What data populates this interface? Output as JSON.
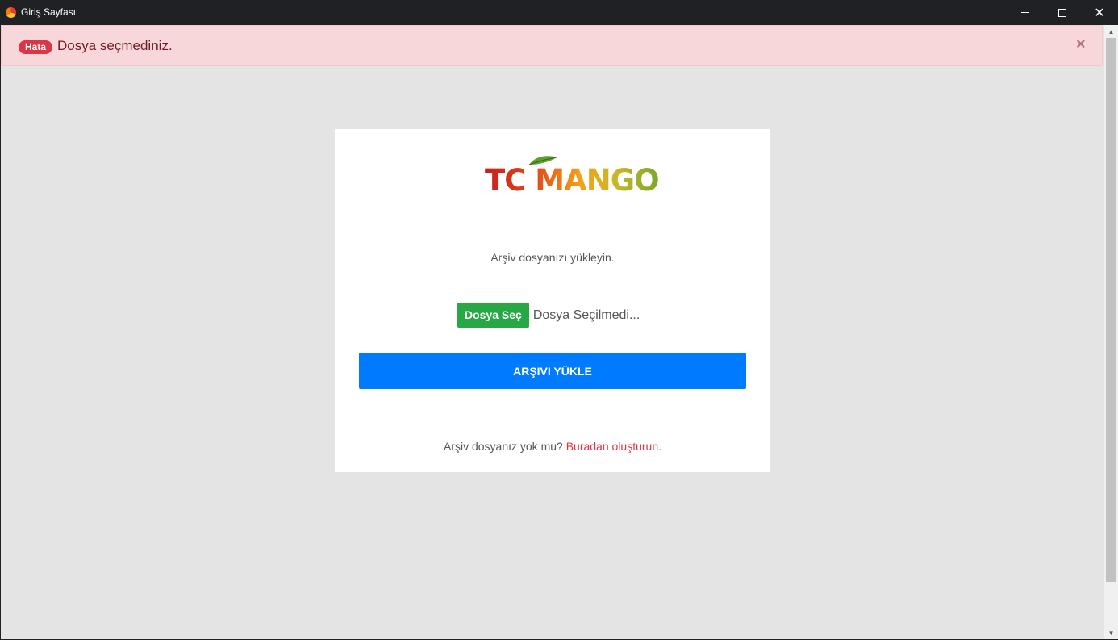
{
  "window": {
    "title": "Giriş Sayfası",
    "close_glyph": "✕"
  },
  "alert": {
    "badge": "Hata",
    "message": "Dosya seçmediniz.",
    "close": "×",
    "colors": {
      "background": "#f8d7da",
      "badge": "#dc3545",
      "text": "#721c24"
    }
  },
  "card": {
    "logo_text": "TC MANGO",
    "instruction": "Arşiv dosyanızı yükleyin.",
    "file_button": "Dosya Seç",
    "file_status": "Dosya Seçilmedi...",
    "upload_button": "ARŞIVI YÜKLE",
    "footer_question": "Arşiv dosyanız yok mu?",
    "footer_link": "Buradan oluşturun.",
    "colors": {
      "file_button": "#28a745",
      "upload_button": "#007bff",
      "link": "#dc3545"
    }
  },
  "icons": {
    "app": "app-icon",
    "minimize": "minimize-icon",
    "maximize": "maximize-icon",
    "close": "close-icon",
    "scroll_up": "scroll-up-arrow-icon",
    "scroll_down": "scroll-down-arrow-icon"
  }
}
